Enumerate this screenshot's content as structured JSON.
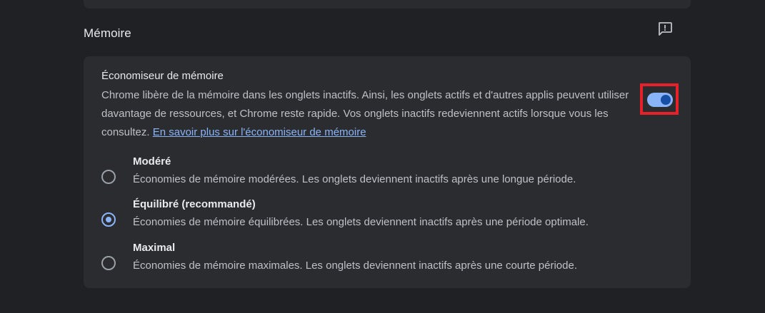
{
  "section": {
    "title": "Mémoire",
    "feedback_icon": "feedback-icon"
  },
  "memory_saver": {
    "title": "Économiseur de mémoire",
    "description": "Chrome libère de la mémoire dans les onglets inactifs. Ainsi, les onglets actifs et d'autres applis peuvent utiliser davantage de ressources, et Chrome reste rapide. Vos onglets inactifs redeviennent actifs lorsque vous les consultez. ",
    "link": "En savoir plus sur l'économiseur de mémoire",
    "enabled": true
  },
  "options": [
    {
      "title": "Modéré",
      "description": "Économies de mémoire modérées. Les onglets deviennent inactifs après une longue période.",
      "selected": false
    },
    {
      "title": "Équilibré (recommandé)",
      "description": "Économies de mémoire équilibrées. Les onglets deviennent inactifs après une période optimale.",
      "selected": true
    },
    {
      "title": "Maximal",
      "description": "Économies de mémoire maximales. Les onglets deviennent inactifs après une courte période.",
      "selected": false
    }
  ],
  "colors": {
    "background": "#202124",
    "card": "#2b2c2f",
    "accent": "#8ab4f8",
    "highlight_border": "#e8202a"
  }
}
